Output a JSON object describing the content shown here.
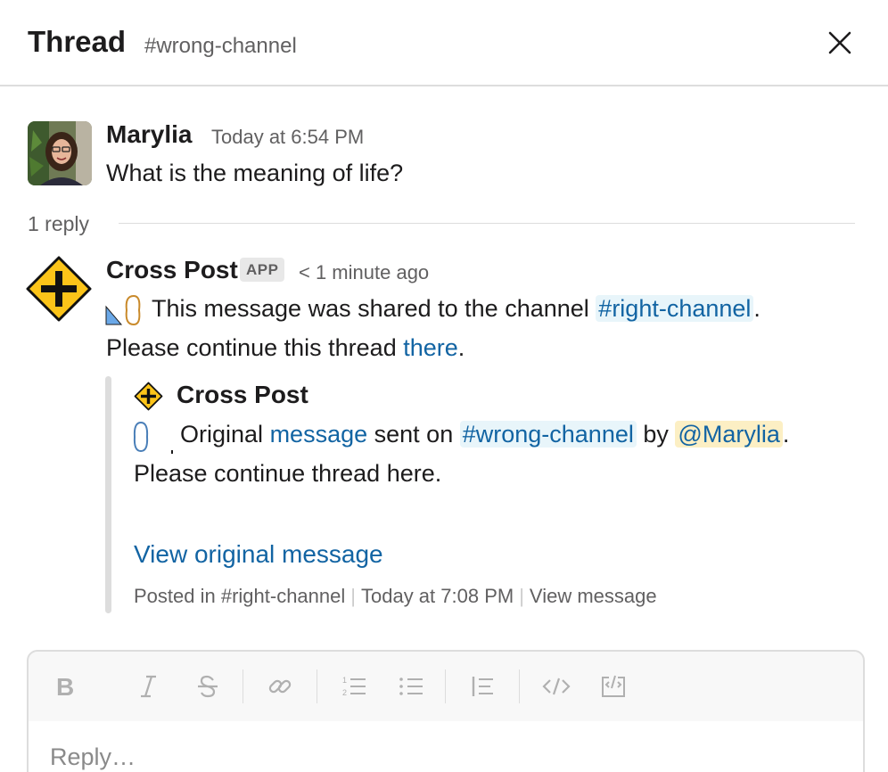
{
  "header": {
    "title": "Thread",
    "channel": "#wrong-channel"
  },
  "parent_message": {
    "author": "Marylia",
    "time": "Today at 6:54 PM",
    "text": "What is the meaning of life?"
  },
  "replies": {
    "count_label": "1 reply"
  },
  "reply_message": {
    "author": "Cross Post",
    "badge": "APP",
    "time": "< 1 minute ago",
    "line1_pre": "This message was shared to the channel",
    "channel_link": "#right-channel",
    "line1_post": ".",
    "line2_pre": "Please continue this thread",
    "there_link": "there",
    "line2_post": "."
  },
  "attachment": {
    "author": "Cross Post",
    "line1_pre": "Original",
    "message_link": "message",
    "line1_mid": "sent on",
    "channel_link": "#wrong-channel",
    "line1_by": "by",
    "mention": "@Marylia",
    "line1_post": ".",
    "line2": "Please continue thread here.",
    "view_original": "View original message",
    "footer": {
      "posted_in": "Posted in #right-channel",
      "time": "Today at 7:08 PM",
      "view_message": "View message"
    }
  },
  "composer": {
    "placeholder": "Reply…"
  },
  "colors": {
    "link": "#1264a3",
    "channel_pill_bg": "#e8f5fa",
    "mention_pill_bg": "#fcefc4",
    "sign_yellow": "#fcc419"
  },
  "icons": {
    "close": "close-icon",
    "app_avatar": "crossroad-sign-icon",
    "toolbar": [
      "bold-icon",
      "italic-icon",
      "strikethrough-icon",
      "link-icon",
      "ordered-list-icon",
      "bulleted-list-icon",
      "blockquote-icon",
      "code-icon",
      "code-block-icon"
    ]
  }
}
